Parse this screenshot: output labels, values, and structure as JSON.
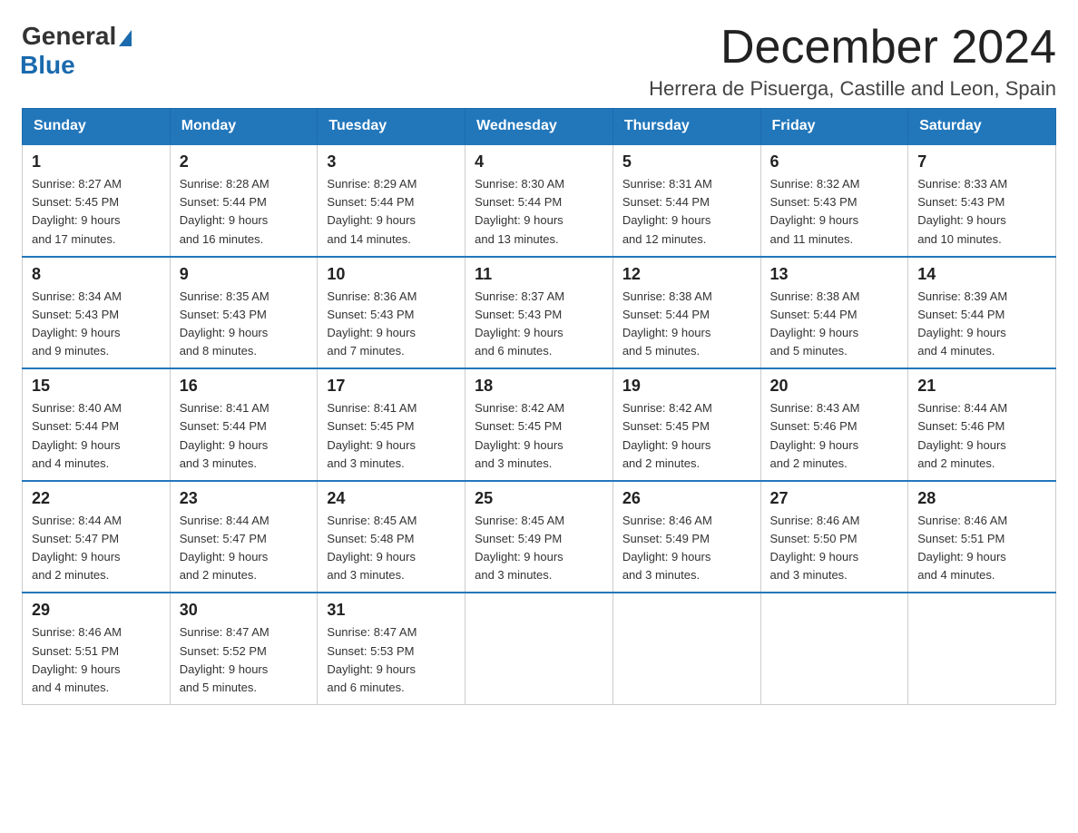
{
  "logo": {
    "general": "General",
    "blue": "Blue"
  },
  "header": {
    "month_title": "December 2024",
    "location": "Herrera de Pisuerga, Castille and Leon, Spain"
  },
  "days_of_week": [
    "Sunday",
    "Monday",
    "Tuesday",
    "Wednesday",
    "Thursday",
    "Friday",
    "Saturday"
  ],
  "weeks": [
    [
      {
        "day": 1,
        "sunrise": "8:27 AM",
        "sunset": "5:45 PM",
        "daylight": "9 hours and 17 minutes."
      },
      {
        "day": 2,
        "sunrise": "8:28 AM",
        "sunset": "5:44 PM",
        "daylight": "9 hours and 16 minutes."
      },
      {
        "day": 3,
        "sunrise": "8:29 AM",
        "sunset": "5:44 PM",
        "daylight": "9 hours and 14 minutes."
      },
      {
        "day": 4,
        "sunrise": "8:30 AM",
        "sunset": "5:44 PM",
        "daylight": "9 hours and 13 minutes."
      },
      {
        "day": 5,
        "sunrise": "8:31 AM",
        "sunset": "5:44 PM",
        "daylight": "9 hours and 12 minutes."
      },
      {
        "day": 6,
        "sunrise": "8:32 AM",
        "sunset": "5:43 PM",
        "daylight": "9 hours and 11 minutes."
      },
      {
        "day": 7,
        "sunrise": "8:33 AM",
        "sunset": "5:43 PM",
        "daylight": "9 hours and 10 minutes."
      }
    ],
    [
      {
        "day": 8,
        "sunrise": "8:34 AM",
        "sunset": "5:43 PM",
        "daylight": "9 hours and 9 minutes."
      },
      {
        "day": 9,
        "sunrise": "8:35 AM",
        "sunset": "5:43 PM",
        "daylight": "9 hours and 8 minutes."
      },
      {
        "day": 10,
        "sunrise": "8:36 AM",
        "sunset": "5:43 PM",
        "daylight": "9 hours and 7 minutes."
      },
      {
        "day": 11,
        "sunrise": "8:37 AM",
        "sunset": "5:43 PM",
        "daylight": "9 hours and 6 minutes."
      },
      {
        "day": 12,
        "sunrise": "8:38 AM",
        "sunset": "5:44 PM",
        "daylight": "9 hours and 5 minutes."
      },
      {
        "day": 13,
        "sunrise": "8:38 AM",
        "sunset": "5:44 PM",
        "daylight": "9 hours and 5 minutes."
      },
      {
        "day": 14,
        "sunrise": "8:39 AM",
        "sunset": "5:44 PM",
        "daylight": "9 hours and 4 minutes."
      }
    ],
    [
      {
        "day": 15,
        "sunrise": "8:40 AM",
        "sunset": "5:44 PM",
        "daylight": "9 hours and 4 minutes."
      },
      {
        "day": 16,
        "sunrise": "8:41 AM",
        "sunset": "5:44 PM",
        "daylight": "9 hours and 3 minutes."
      },
      {
        "day": 17,
        "sunrise": "8:41 AM",
        "sunset": "5:45 PM",
        "daylight": "9 hours and 3 minutes."
      },
      {
        "day": 18,
        "sunrise": "8:42 AM",
        "sunset": "5:45 PM",
        "daylight": "9 hours and 3 minutes."
      },
      {
        "day": 19,
        "sunrise": "8:42 AM",
        "sunset": "5:45 PM",
        "daylight": "9 hours and 2 minutes."
      },
      {
        "day": 20,
        "sunrise": "8:43 AM",
        "sunset": "5:46 PM",
        "daylight": "9 hours and 2 minutes."
      },
      {
        "day": 21,
        "sunrise": "8:44 AM",
        "sunset": "5:46 PM",
        "daylight": "9 hours and 2 minutes."
      }
    ],
    [
      {
        "day": 22,
        "sunrise": "8:44 AM",
        "sunset": "5:47 PM",
        "daylight": "9 hours and 2 minutes."
      },
      {
        "day": 23,
        "sunrise": "8:44 AM",
        "sunset": "5:47 PM",
        "daylight": "9 hours and 2 minutes."
      },
      {
        "day": 24,
        "sunrise": "8:45 AM",
        "sunset": "5:48 PM",
        "daylight": "9 hours and 3 minutes."
      },
      {
        "day": 25,
        "sunrise": "8:45 AM",
        "sunset": "5:49 PM",
        "daylight": "9 hours and 3 minutes."
      },
      {
        "day": 26,
        "sunrise": "8:46 AM",
        "sunset": "5:49 PM",
        "daylight": "9 hours and 3 minutes."
      },
      {
        "day": 27,
        "sunrise": "8:46 AM",
        "sunset": "5:50 PM",
        "daylight": "9 hours and 3 minutes."
      },
      {
        "day": 28,
        "sunrise": "8:46 AM",
        "sunset": "5:51 PM",
        "daylight": "9 hours and 4 minutes."
      }
    ],
    [
      {
        "day": 29,
        "sunrise": "8:46 AM",
        "sunset": "5:51 PM",
        "daylight": "9 hours and 4 minutes."
      },
      {
        "day": 30,
        "sunrise": "8:47 AM",
        "sunset": "5:52 PM",
        "daylight": "9 hours and 5 minutes."
      },
      {
        "day": 31,
        "sunrise": "8:47 AM",
        "sunset": "5:53 PM",
        "daylight": "9 hours and 6 minutes."
      },
      null,
      null,
      null,
      null
    ]
  ],
  "labels": {
    "sunrise": "Sunrise:",
    "sunset": "Sunset:",
    "daylight": "Daylight:"
  }
}
